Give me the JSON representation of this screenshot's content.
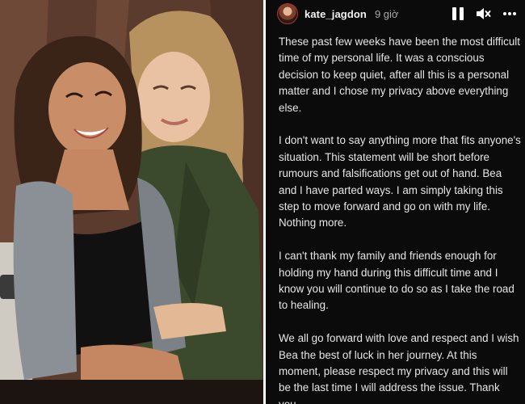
{
  "photo": {
    "description_icon": "photo-of-two-women"
  },
  "story": {
    "username": "kate_jagdon",
    "time_ago": "9 giờ",
    "icons": {
      "pause": "pause-icon",
      "mute": "speaker-muted-icon",
      "more": "more-options-icon"
    },
    "paragraphs": [
      "These past few weeks have been the most difficult time of my personal life. It was a conscious decision to keep quiet, after all this is a personal matter and I chose my privacy above everything else.",
      "I don't want to say anything more that fits anyone's situation. This statement will be short before rumours and falsifications get out of hand. Bea and I have parted ways. I am simply taking this step to move forward and go on with my life. Nothing more.",
      "I can't thank my family and friends enough for holding my hand during this difficult time and I know you will continue to do so as I take the road to healing.",
      "We all go forward with love and respect and I wish Bea the best of luck in her journey. At this moment, please respect my privacy and this will be the last time I will address the issue. Thank you."
    ]
  },
  "colors": {
    "story_background": "#0b0b0b",
    "story_text": "#e6e6e6",
    "time_text": "#a9a9a9"
  }
}
